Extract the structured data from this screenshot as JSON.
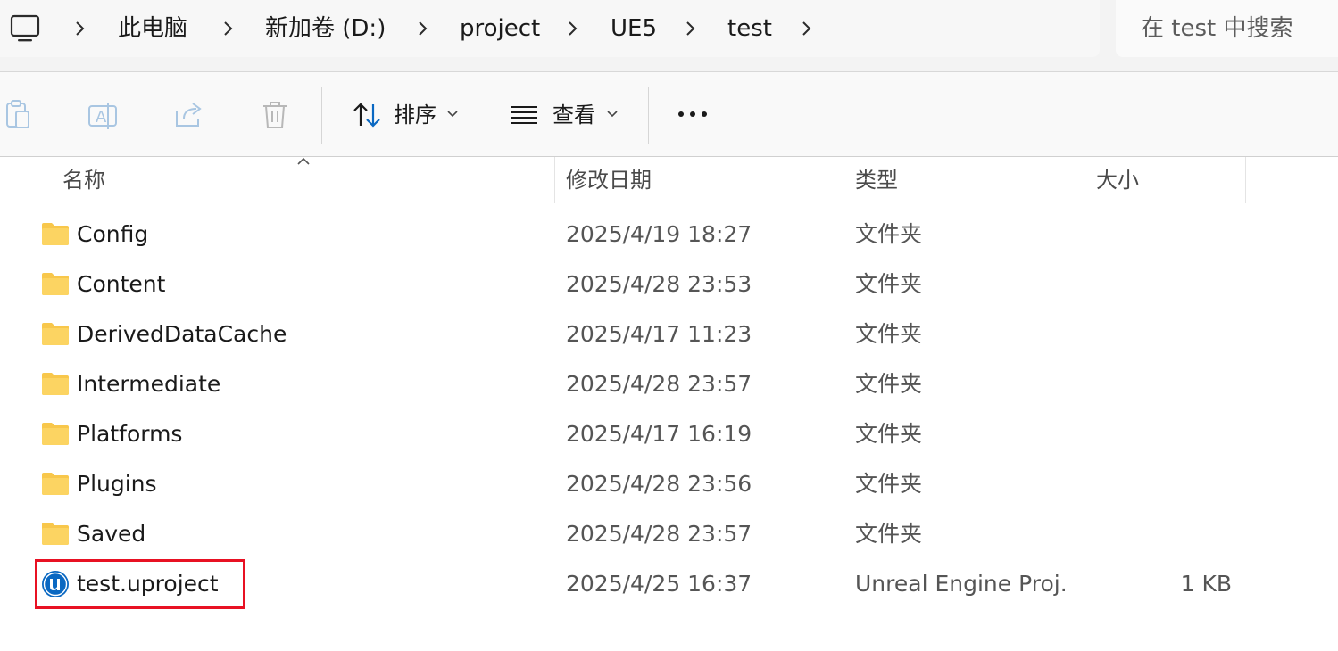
{
  "address_bar": {
    "crumbs": [
      "此电脑",
      "新加卷 (D:)",
      "project",
      "UE5",
      "test"
    ]
  },
  "search": {
    "placeholder": "在 test 中搜索"
  },
  "command_bar": {
    "sort_label": "排序",
    "view_label": "查看"
  },
  "columns": {
    "name": "名称",
    "date": "修改日期",
    "type": "类型",
    "size": "大小"
  },
  "files": [
    {
      "name": "Config",
      "date": "2025/4/19 18:27",
      "type": "文件夹",
      "size": "",
      "icon": "folder-icon"
    },
    {
      "name": "Content",
      "date": "2025/4/28 23:53",
      "type": "文件夹",
      "size": "",
      "icon": "folder-icon"
    },
    {
      "name": "DerivedDataCache",
      "date": "2025/4/17 11:23",
      "type": "文件夹",
      "size": "",
      "icon": "folder-icon"
    },
    {
      "name": "Intermediate",
      "date": "2025/4/28 23:57",
      "type": "文件夹",
      "size": "",
      "icon": "folder-icon"
    },
    {
      "name": "Platforms",
      "date": "2025/4/17 16:19",
      "type": "文件夹",
      "size": "",
      "icon": "folder-icon"
    },
    {
      "name": "Plugins",
      "date": "2025/4/28 23:56",
      "type": "文件夹",
      "size": "",
      "icon": "folder-icon"
    },
    {
      "name": "Saved",
      "date": "2025/4/28 23:57",
      "type": "文件夹",
      "size": "",
      "icon": "folder-icon"
    },
    {
      "name": "test.uproject",
      "date": "2025/4/25 16:37",
      "type": "Unreal Engine Proj...",
      "size": "1 KB",
      "icon": "unreal-engine-icon",
      "highlighted": true
    }
  ],
  "colors": {
    "highlight_border": "#e81123",
    "folder": "#f8c74b",
    "unreal_badge": "#0a68c2"
  }
}
